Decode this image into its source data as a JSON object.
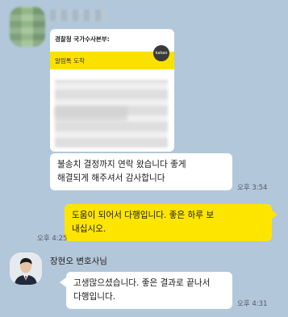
{
  "top_sender": {
    "name_hidden": true
  },
  "card": {
    "title": "경찰청 국가수사본부:",
    "header_label": "알림톡 도착",
    "badge": "kakao"
  },
  "messages": [
    {
      "sender": "other",
      "text_line1": "불송치 결정까지 연락 왔습니다 좋게",
      "text_line2": "해결되게 해주셔서 감사합니다",
      "time": "오후 3:54"
    },
    {
      "sender": "me",
      "text_line1": "도움이 되어서 다행입니다. 좋은 하루 보",
      "text_line2": "내십시오.",
      "time": "오후 4:25"
    },
    {
      "sender": "other",
      "sender_name": "장현오 변호사님",
      "text_line1": "고생많으셨습니다. 좋은 결과로 끝나서",
      "text_line2": "다행입니다.",
      "time": "오후 4:31"
    }
  ],
  "colors": {
    "background": "#b2c7d9",
    "my_bubble": "#fee500",
    "their_bubble": "#ffffff",
    "card_header": "#fae100"
  }
}
